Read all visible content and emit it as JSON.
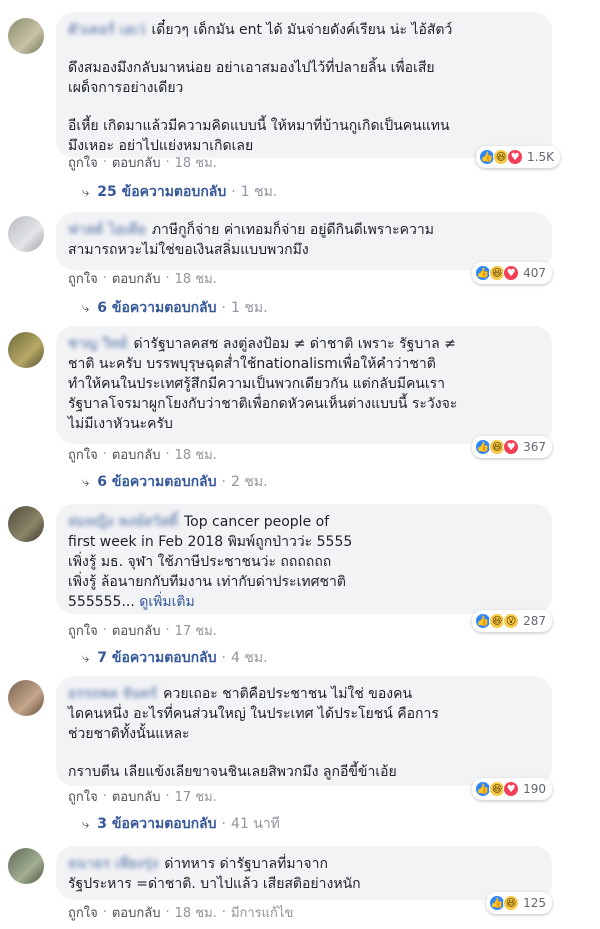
{
  "labels": {
    "like": "ถูกใจ",
    "reply": "ตอบกลับ",
    "separator": "·",
    "see_more": "ดูเพิ่มเติม"
  },
  "comments": [
    {
      "author": "ตัวเตอร์ เอเว่",
      "paragraphs": [
        "เดี๋ยวๆ เด็กมัน ent ได้ มันจ่ายดังค์เรียน น่ะ ไอ้สัตว์",
        "ดึงสมองมึงกลับมาหน่อย อย่าเอาสมองไปไว้ที่ปลายลิ้น เพื่อเสีย\nเผด็จการอย่างเดียว",
        "อีเหี้ย เกิดมาแล้วมีความคิดแบบนี้ ให้หมาที่บ้านกูเกิดเป็นคนแทน\nมึงเหอะ อย่าไปแย่งหมาเกิดเลย"
      ],
      "time": "18 ชม.",
      "edited": "",
      "reactions": [
        "like",
        "haha",
        "love"
      ],
      "reaction_count": "1.5K",
      "replies": "25 ข้อความตอบกลับ",
      "replies_time": "1 ชม."
    },
    {
      "author": "ฟาสต์ ไอเดีย",
      "paragraphs": [
        "ภาษีกูก็จ่าย ค่าเทอมก็จ่าย อยู่ดีกินดีเพราะความ\nสามารถหวะไม่ใช่ขอเงินสลิ่มแบบพวกมึง"
      ],
      "time": "18 ชม.",
      "edited": "",
      "reactions": [
        "like",
        "haha",
        "love"
      ],
      "reaction_count": "407",
      "replies": "6 ข้อความตอบกลับ",
      "replies_time": "1 ชม."
    },
    {
      "author": "ชาญ วิทย์",
      "paragraphs": [
        "ด่ารัฐบาลคสช ลงตู่ลงป้อม ≠ ด่าชาติ เพราะ รัฐบาล ≠\nชาติ นะครับ บรรพบุรุษฉุดส่ำใช้nationalismเพื่อให้คำว่าชาติ\nทำให้คนในประเทศรู้สึกมีความเป็นพวกเดียวกัน แต่กลับมีคนเรา\nรัฐบาลโจรมาผูกโยงกับว่าชาติเพื่อกดหัวคนเห็นต่างแบบนี้ ระวังจะ\nไม่มีเงาหัวนะครับ"
      ],
      "time": "18 ชม.",
      "edited": "",
      "reactions": [
        "like",
        "haha",
        "love"
      ],
      "reaction_count": "367",
      "replies": "6 ข้อความตอบกลับ",
      "replies_time": "2 ชม."
    },
    {
      "author": "สมหญิง พงษ์สวัสดิ์",
      "paragraphs": [
        "Top cancer people of\nfirst week in Feb 2018 พิมพ์ถูกป่าวว่ะ 5555\nเพิ่งรู้ มธ. จุฬา ใช้ภาษีประชาชนว่ะ ถถถถถถ\nเพิ่งรู้ ล้อนายกกับทีมงาน เท่ากับด่าประเทศชาติ\n555555..."
      ],
      "see_more": true,
      "time": "17 ชม.",
      "edited": "",
      "reactions": [
        "like",
        "haha",
        "wow"
      ],
      "reaction_count": "287",
      "replies": "7 ข้อความตอบกลับ",
      "replies_time": "4 ชม."
    },
    {
      "author": "อรรถพล จันทร์",
      "paragraphs": [
        "ควยเถอะ ชาติคือประชาชน ไม่ใช่ ของคน\nไดคนหนึ่ง อะไรที่คนส่วนใหญ่ ในประเทศ ได้ประโยชน์ คือการ\nช่วยชาติทั้งนั้นแหละ",
        "กราบตีน เลียแข้งเลียขาจนชินเลยสิพวกมึง ลูกอีขี้ข้าเอ้ย"
      ],
      "time": "17 ชม.",
      "edited": "",
      "reactions": [
        "like",
        "haha",
        "love"
      ],
      "reaction_count": "190",
      "replies": "3 ข้อความตอบกลับ",
      "replies_time": "41 นาที"
    },
    {
      "author": "ธนาธร เพียงรุ่ง",
      "paragraphs": [
        "ด่าทหาร ด่ารัฐบาลที่มาจาก\nรัฐประหาร =ด่าชาติ. บาไปแล้ว เสียสติอย่างหนัก"
      ],
      "time": "18 ชม.",
      "edited": "มีการแก้ไข",
      "reactions": [
        "like",
        "haha"
      ],
      "reaction_count": "125",
      "replies": "",
      "replies_time": ""
    }
  ]
}
